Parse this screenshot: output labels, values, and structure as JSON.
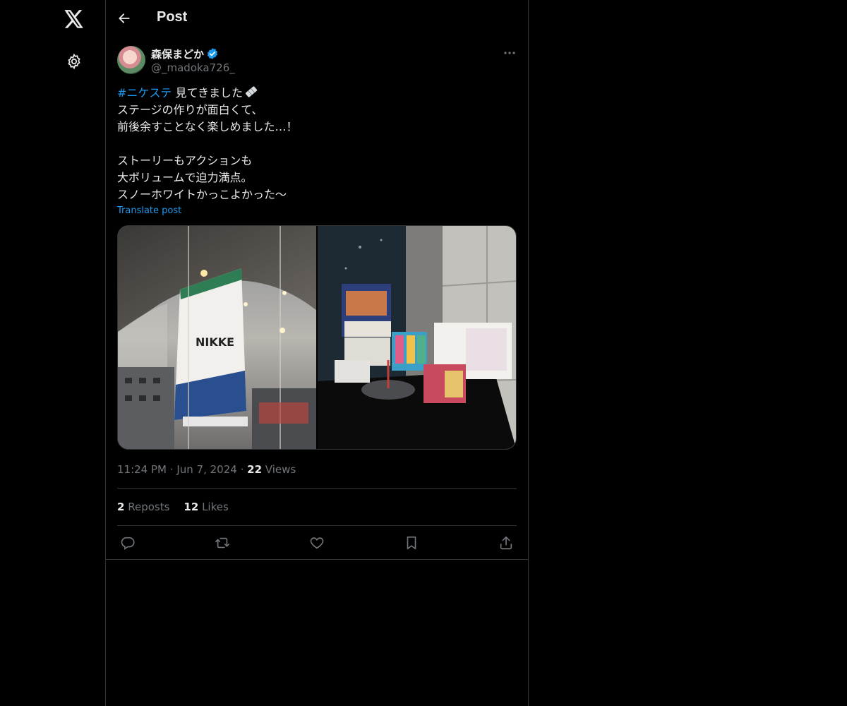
{
  "nav": {
    "logo_icon": "x-logo-icon",
    "settings_icon": "gear-icon"
  },
  "header": {
    "title": "Post",
    "back_icon": "arrow-left-icon"
  },
  "post": {
    "author": {
      "display_name": "森保まどか",
      "handle": "@_madoka726_",
      "verified": true
    },
    "text": {
      "hashtag": "#ニケステ",
      "first_line_rest": " 見てきました",
      "rest": "ステージの作りが面白くて、\n前後余すことなく楽しめました…！\n\nストーリーもアクションも\n大ボリュームで迫力満点。\nスノーホワイトかっこよかった〜"
    },
    "translate_label": "Translate post",
    "time": "11:24 PM",
    "separator": "·",
    "date": "Jun 7, 2024",
    "views_count": "22",
    "views_label": "Views",
    "reposts_count": "2",
    "reposts_label": "Reposts",
    "likes_count": "12",
    "likes_label": "Likes"
  },
  "colors": {
    "background": "#000000",
    "text": "#e7e9ea",
    "muted": "#71767b",
    "accent": "#1d9bf0",
    "border": "#2f3336"
  }
}
